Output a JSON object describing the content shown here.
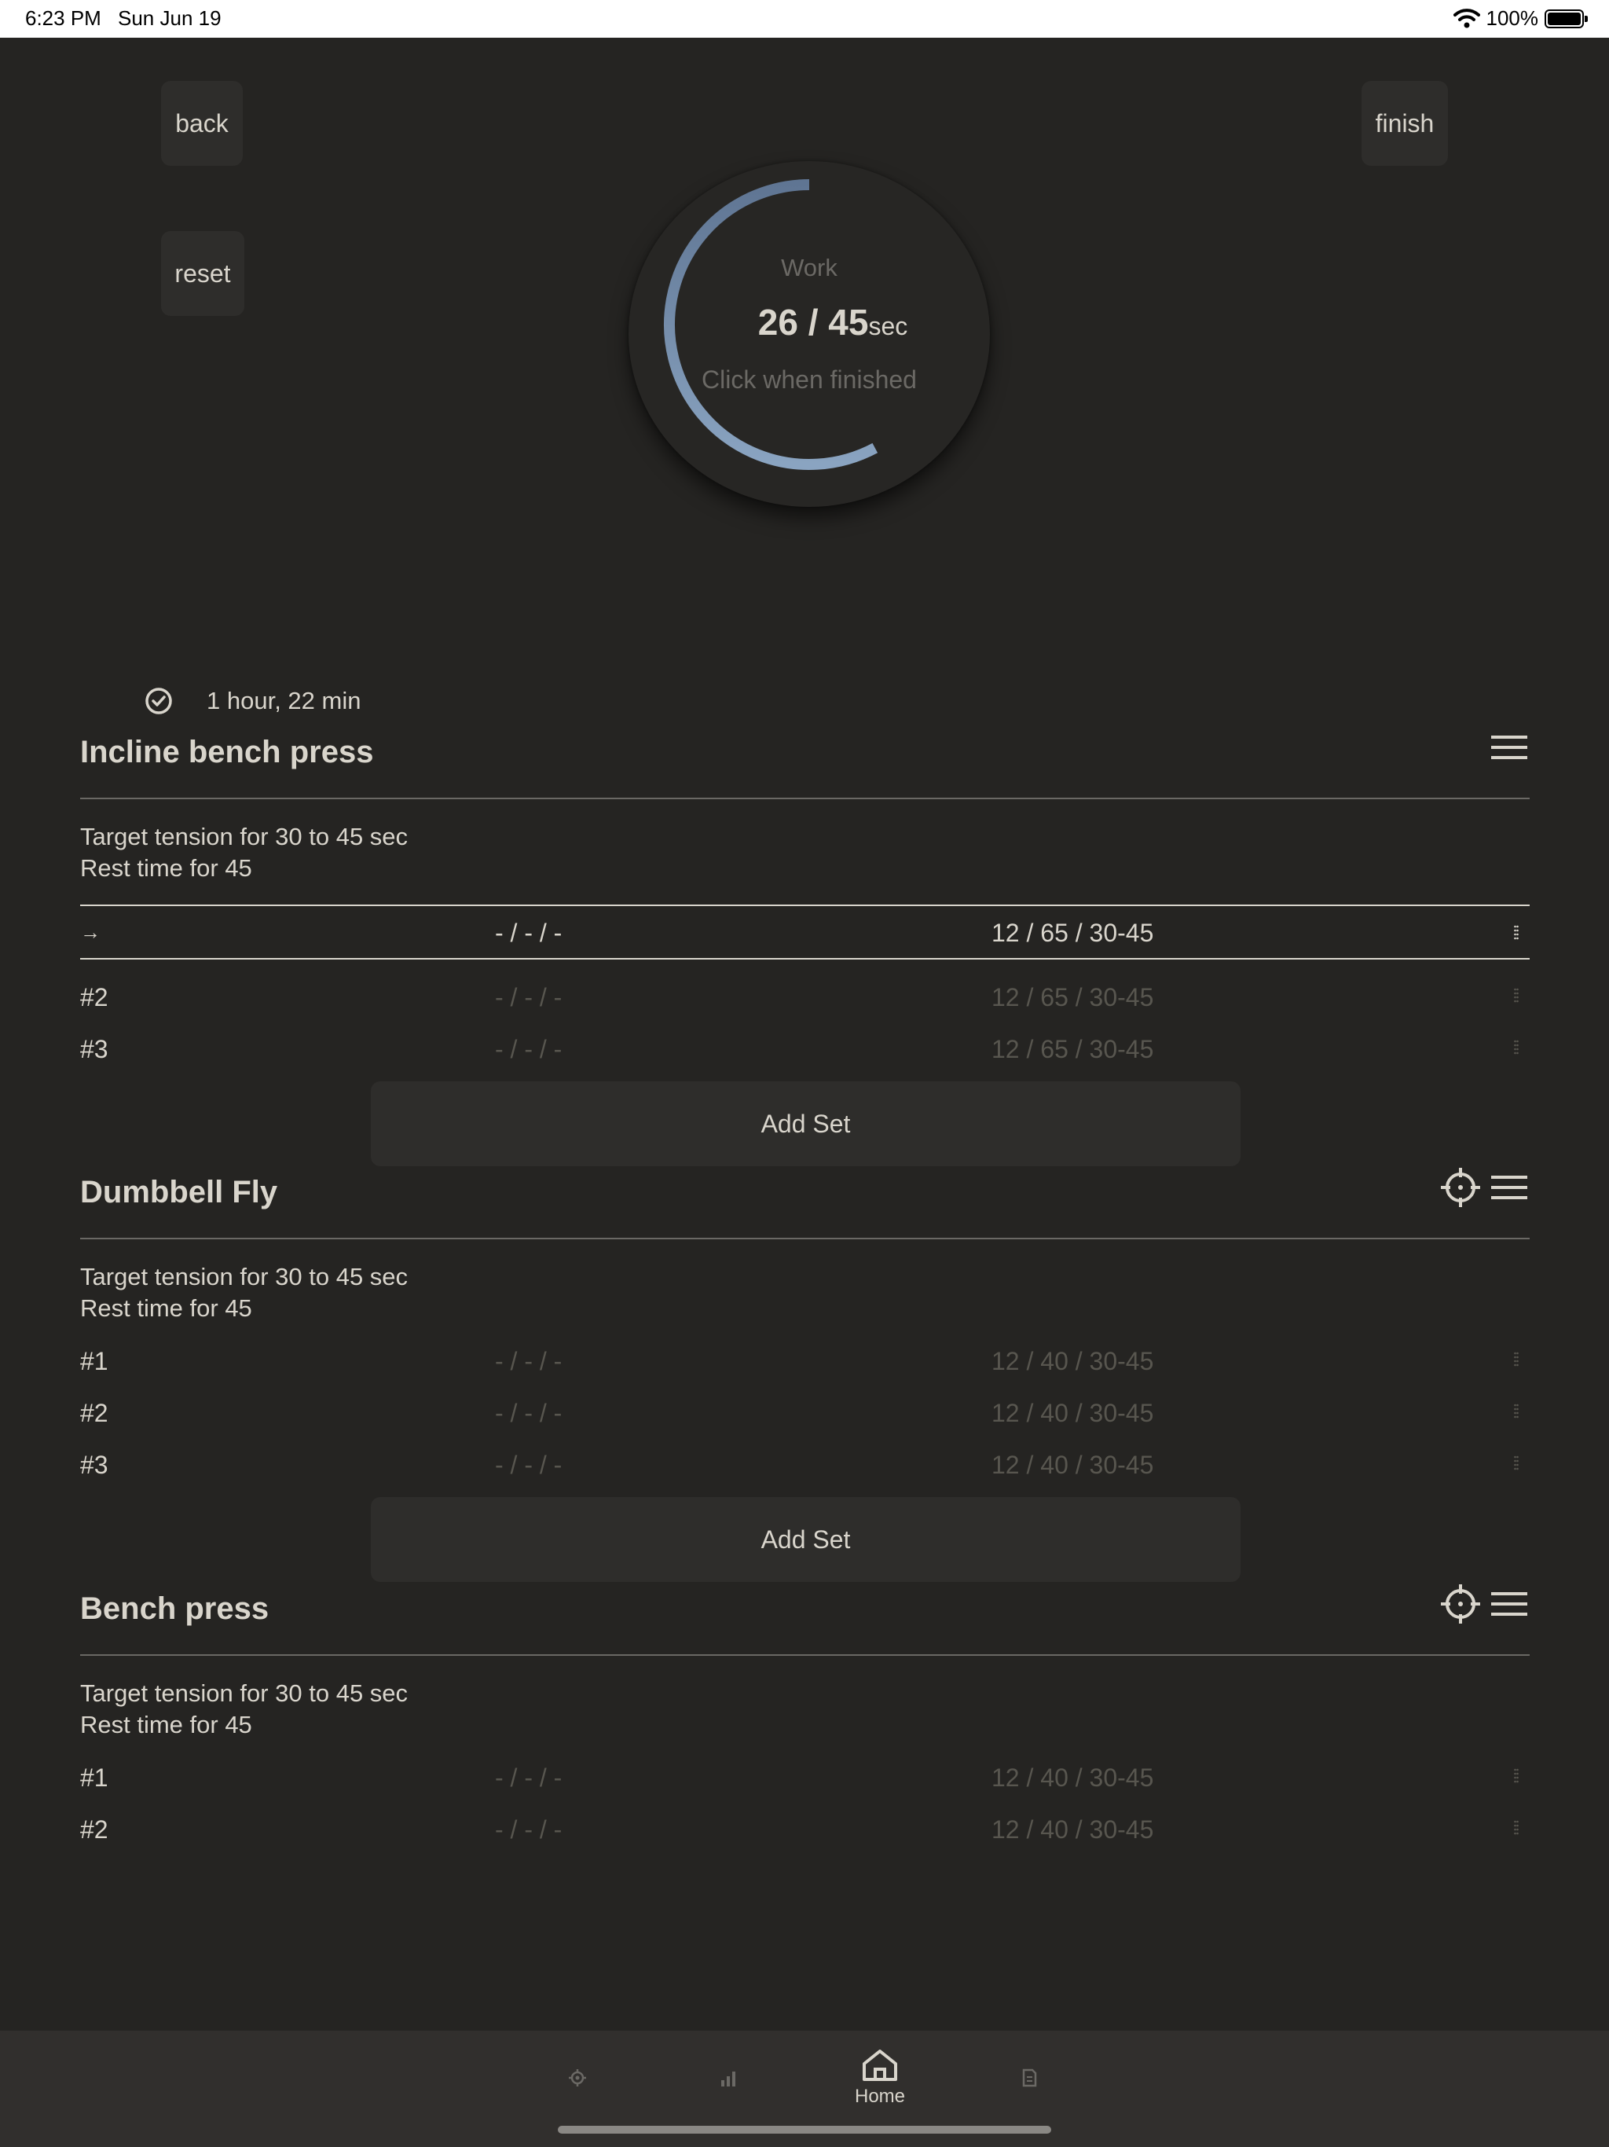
{
  "status_bar": {
    "time": "6:23 PM",
    "date": "Sun Jun 19",
    "battery_pct": "100%"
  },
  "buttons": {
    "back": "back",
    "reset": "reset",
    "finish": "finish"
  },
  "timer": {
    "label": "Work",
    "current": "26",
    "separator": " / ",
    "total": "45",
    "unit": "sec",
    "hint": "Click when finished",
    "progress": 0.578,
    "accent_color": "#7f9ab8"
  },
  "duration": "1 hour, 22 min",
  "exercises": [
    {
      "title": "Incline bench press",
      "tension": "Target tension for 30 to 45 sec",
      "rest": "Rest time for 45",
      "sets": [
        {
          "index": "→",
          "done": "- / - / -",
          "target": "12 / 65 / 30-45"
        },
        {
          "index": "#2",
          "done": "- / - / -",
          "target": "12 / 65 / 30-45"
        },
        {
          "index": "#3",
          "done": "- / - / -",
          "target": "12 / 65 / 30-45"
        }
      ],
      "add_set": "Add Set"
    },
    {
      "title": "Dumbbell Fly",
      "tension": "Target tension for 30 to 45 sec",
      "rest": "Rest time for 45",
      "sets": [
        {
          "index": "#1",
          "done": "- / - / -",
          "target": "12 / 40 / 30-45"
        },
        {
          "index": "#2",
          "done": "- / - / -",
          "target": "12 / 40 / 30-45"
        },
        {
          "index": "#3",
          "done": "- / - / -",
          "target": "12 / 40 / 30-45"
        }
      ],
      "add_set": "Add Set"
    },
    {
      "title": "Bench press",
      "tension": "Target tension for 30 to 45 sec",
      "rest": "Rest time for 45",
      "sets": [
        {
          "index": "#1",
          "done": "- / - / -",
          "target": "12 / 40 / 30-45"
        },
        {
          "index": "#2",
          "done": "- / - / -",
          "target": "12 / 40 / 30-45"
        }
      ]
    }
  ],
  "tab_bar": {
    "home_label": "Home"
  }
}
